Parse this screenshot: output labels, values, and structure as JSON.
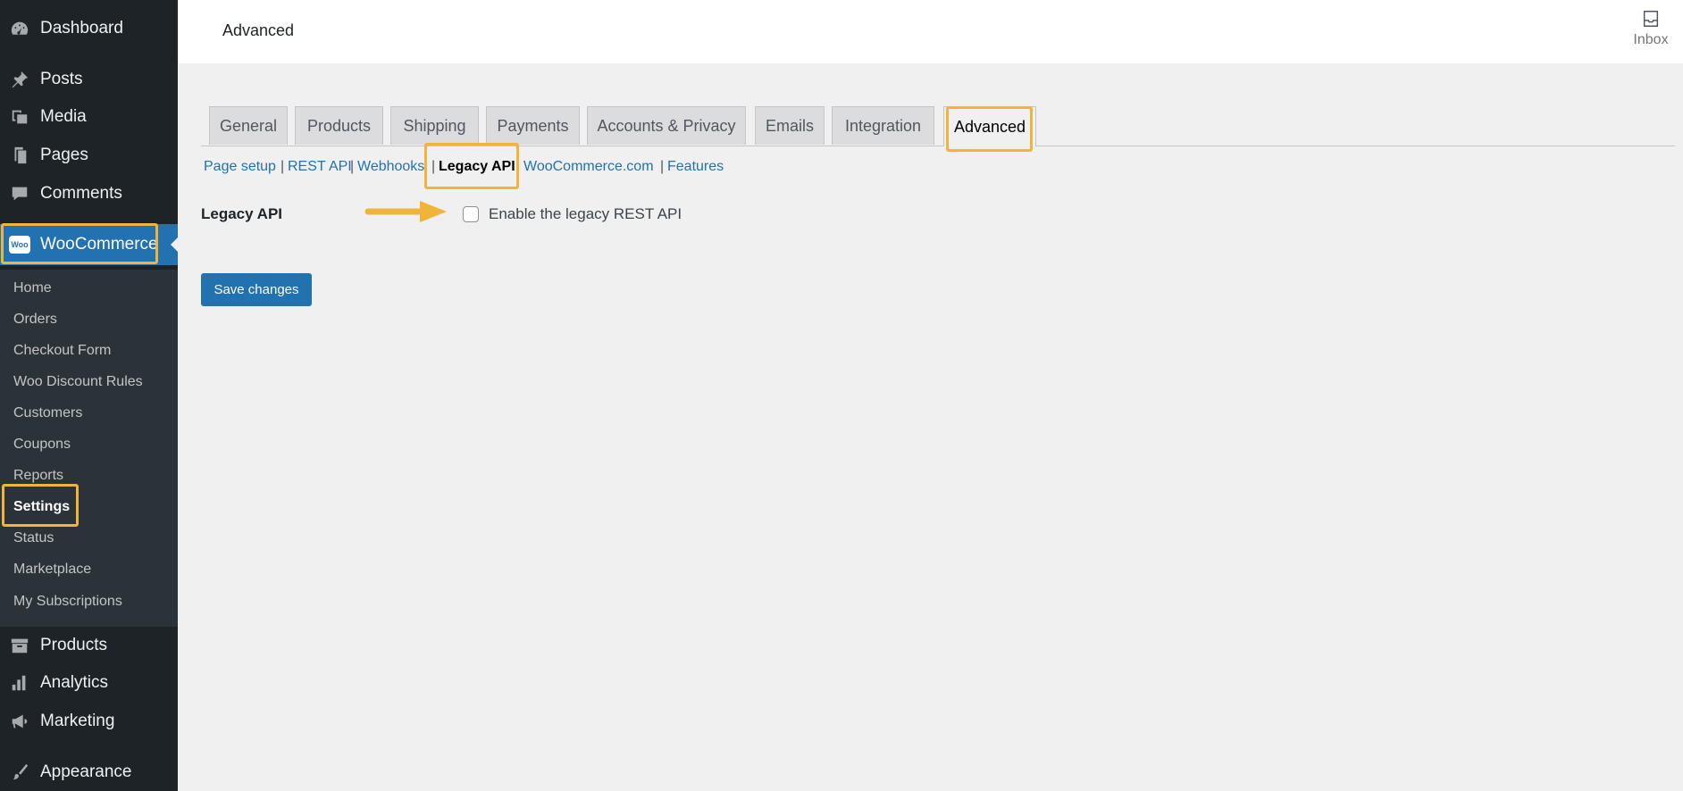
{
  "sidebar": {
    "top_items": [
      {
        "label": "Dashboard",
        "icon": "dashboard-icon"
      },
      {
        "label": "Posts",
        "icon": "pushpin-icon"
      },
      {
        "label": "Media",
        "icon": "media-icon"
      },
      {
        "label": "Pages",
        "icon": "pages-icon"
      },
      {
        "label": "Comments",
        "icon": "comment-icon"
      }
    ],
    "woocommerce": {
      "label": "WooCommerce",
      "icon": "woo-logo-icon",
      "logo_text": "Woo"
    },
    "submenu": [
      "Home",
      "Orders",
      "Checkout Form",
      "Woo Discount Rules",
      "Customers",
      "Coupons",
      "Reports",
      "Settings",
      "Status",
      "Marketplace",
      "My Subscriptions"
    ],
    "current_submenu": "Settings",
    "bottom_items": [
      {
        "label": "Products",
        "icon": "archive-icon"
      },
      {
        "label": "Analytics",
        "icon": "bar-chart-icon"
      },
      {
        "label": "Marketing",
        "icon": "megaphone-icon"
      },
      {
        "label": "Appearance",
        "icon": "brush-icon"
      }
    ]
  },
  "header": {
    "title": "Advanced",
    "inbox_label": "Inbox"
  },
  "tabs": [
    "General",
    "Products",
    "Shipping",
    "Payments",
    "Accounts & Privacy",
    "Emails",
    "Integration",
    "Advanced"
  ],
  "active_tab": "Advanced",
  "subnav": {
    "links": [
      "Page setup",
      "REST API",
      "Webhooks",
      "Legacy API",
      "WooCommerce.com",
      "Features"
    ],
    "separator": "|",
    "current": "Legacy API"
  },
  "form": {
    "field_label": "Legacy API",
    "checkbox_label": "Enable the legacy REST API",
    "save_label": "Save changes"
  },
  "colors": {
    "accent": "#2271b1",
    "highlight": "#f0b43a",
    "sidebar_bg": "#1d2327"
  }
}
